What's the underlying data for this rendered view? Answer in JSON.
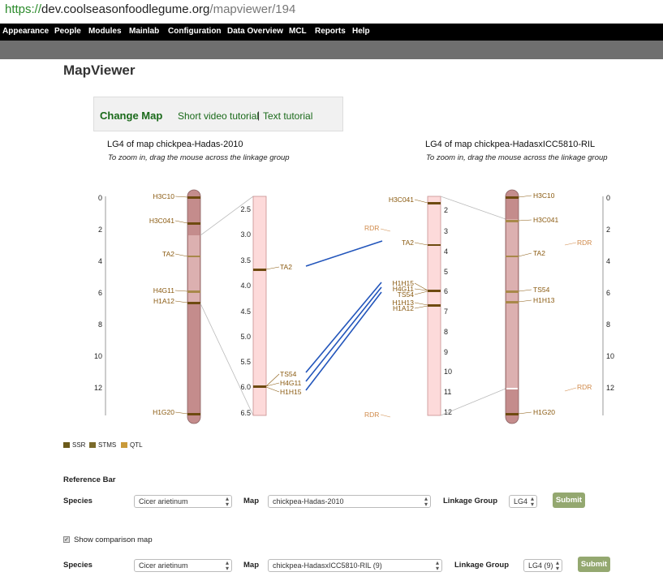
{
  "browser": {
    "url_scheme": "https://",
    "url_host": "dev.coolseasonfoodlegume.org",
    "url_path": "/mapviewer/194"
  },
  "nav": {
    "items": [
      "Appearance",
      "People",
      "Modules",
      "Mainlab",
      "Configuration",
      "Data Overview",
      "MCL",
      "Reports",
      "Help"
    ]
  },
  "page": {
    "title": "MapViewer",
    "change_map": "Change Map",
    "video_tutorial": "Short video tutorial",
    "separator": "|",
    "text_tutorial": "Text tutorial"
  },
  "left_map": {
    "title": "LG4 of map chickpea-Hadas-2010",
    "zoom_hint": "To zoom in, drag the mouse across the linkage group",
    "scale_ticks": [
      "0",
      "2",
      "4",
      "6",
      "8",
      "10",
      "12"
    ],
    "markers": [
      "H3C10",
      "H3C041",
      "TA2",
      "H4G11",
      "H1A12",
      "H1G20"
    ],
    "zoom_ticks": [
      "2.5",
      "3.0",
      "3.5",
      "4.0",
      "4.5",
      "5.0",
      "5.5",
      "6.0",
      "6.5"
    ],
    "zoom_markers": [
      "TA2",
      "TS54",
      "H4G11",
      "H1H15"
    ]
  },
  "right_map": {
    "title": "LG4 of map chickpea-HadasxICC5810-RIL",
    "zoom_hint": "To zoom in, drag the mouse across the linkage group",
    "zoom_ticks": [
      "2",
      "3",
      "4",
      "5",
      "6",
      "7",
      "8",
      "9",
      "10",
      "11",
      "12"
    ],
    "zoom_markers": [
      "H3C041",
      "TA2",
      "H1H15",
      "H4G11",
      "TS54",
      "H1H13",
      "H1A12"
    ],
    "qtl_labels": [
      "RDR",
      "RDR"
    ],
    "markers": [
      "H3C10",
      "H3C041",
      "TA2",
      "TS54",
      "H1H13",
      "H1G20"
    ],
    "qtl_right": [
      "RDR",
      "RDR"
    ],
    "scale_ticks": [
      "0",
      "2",
      "4",
      "6",
      "8",
      "10",
      "12"
    ]
  },
  "legend": {
    "items": [
      {
        "label": "SSR",
        "color": "#6b5a1a"
      },
      {
        "label": "STMS",
        "color": "#7a6a2a"
      },
      {
        "label": "QTL",
        "color": "#c99a3a"
      }
    ]
  },
  "colors": {
    "chrom_fill": "#c48c8c",
    "chrom_light": "#dcb0b0",
    "zoom_fill": "#fddada",
    "marker_dark": "#6e4a10",
    "marker_light": "#a8884a",
    "label_brown": "#8a5a10",
    "qtl_label": "#d08a4a",
    "link_blue": "#2255bb"
  },
  "reference_bar": {
    "heading": "Reference Bar",
    "species_label": "Species",
    "species_value": "Cicer arietinum",
    "map_label": "Map",
    "map_value": "chickpea-Hadas-2010",
    "lg_label": "Linkage Group",
    "lg_value": "LG4",
    "submit": "Submit"
  },
  "comparison": {
    "show_label": "Show comparison map",
    "checked": true,
    "checkmark": "✓",
    "species_label": "Species",
    "species_value": "Cicer arietinum",
    "map_label": "Map",
    "map_value": "chickpea-HadasxICC5810-RIL (9)",
    "lg_label": "Linkage Group",
    "lg_value": "LG4 (9)",
    "submit": "Submit"
  }
}
